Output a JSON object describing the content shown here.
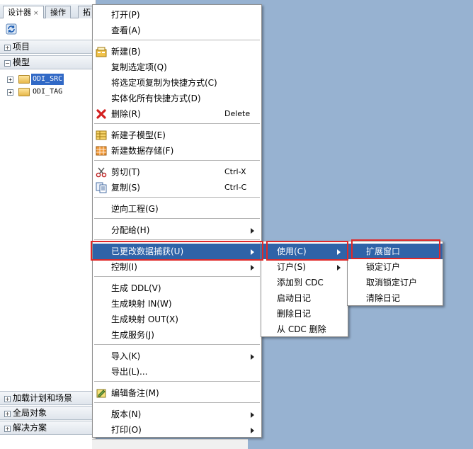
{
  "nav": {
    "tabs": [
      {
        "label": "设计器",
        "close": "×"
      },
      {
        "label": "操作"
      },
      {
        "label": "拓"
      }
    ],
    "sections": {
      "project": "项目",
      "model": "模型",
      "loadplan": "加载计划和场景",
      "global": "全局对象",
      "solution": "解决方案"
    },
    "tree": [
      {
        "label": "ODI_SRC"
      },
      {
        "label": "ODI_TAG"
      }
    ]
  },
  "context_menu": {
    "items": [
      {
        "label": "打开(P)"
      },
      {
        "label": "查看(A)"
      },
      {
        "label": "新建(B)"
      },
      {
        "label": "复制选定项(Q)"
      },
      {
        "label": "将选定项复制为快捷方式(C)"
      },
      {
        "label": "实体化所有快捷方式(D)"
      },
      {
        "label": "删除(R)",
        "shortcut": "Delete"
      },
      {
        "label": "新建子模型(E)"
      },
      {
        "label": "新建数据存储(F)"
      },
      {
        "label": "剪切(T)",
        "shortcut": "Ctrl-X"
      },
      {
        "label": "复制(S)",
        "shortcut": "Ctrl-C"
      },
      {
        "label": "逆向工程(G)"
      },
      {
        "label": "分配给(H)"
      },
      {
        "label": "已更改数据捕获(U)"
      },
      {
        "label": "控制(I)"
      },
      {
        "label": "生成 DDL(V)"
      },
      {
        "label": "生成映射 IN(W)"
      },
      {
        "label": "生成映射 OUT(X)"
      },
      {
        "label": "生成服务(J)"
      },
      {
        "label": "导入(K)"
      },
      {
        "label": "导出(L)..."
      },
      {
        "label": "编辑备注(M)"
      },
      {
        "label": "版本(N)"
      },
      {
        "label": "打印(O)"
      }
    ]
  },
  "cdc_menu": {
    "items": [
      {
        "label": "使用(C)"
      },
      {
        "label": "订户(S)"
      },
      {
        "label": "添加到 CDC"
      },
      {
        "label": "启动日记"
      },
      {
        "label": "删除日记"
      },
      {
        "label": "从 CDC 删除"
      }
    ]
  },
  "use_menu": {
    "items": [
      {
        "label": "扩展窗口"
      },
      {
        "label": "锁定订户"
      },
      {
        "label": "取消锁定订户"
      },
      {
        "label": "清除日记"
      }
    ]
  },
  "colors": {
    "highlight": "#2f63a8",
    "annotation": "#e02828",
    "desktop": "#97b2d1"
  }
}
